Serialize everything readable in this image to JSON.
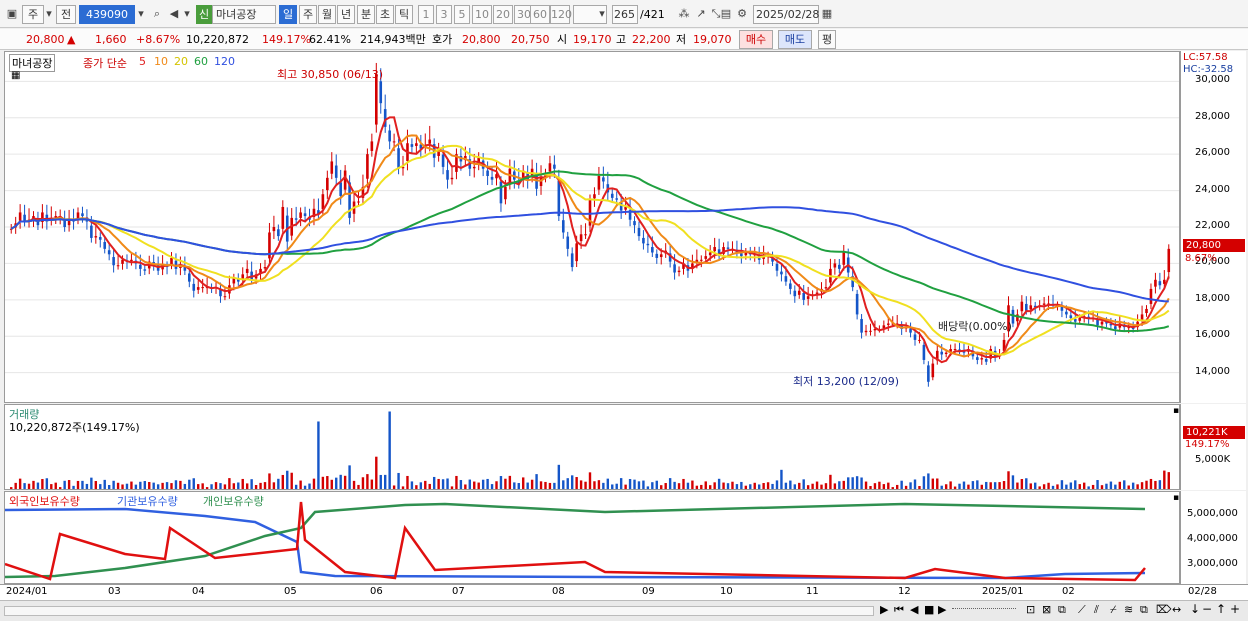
{
  "toolbar": {
    "market": "주",
    "prev": "전",
    "code": "439090",
    "badge": "신",
    "name": "마녀공장",
    "periods": [
      "일",
      "주",
      "월",
      "년",
      "분",
      "초",
      "틱"
    ],
    "active_period": "일",
    "intervals": [
      "1",
      "3",
      "5",
      "10",
      "20",
      "30",
      "60",
      "120"
    ],
    "count": "265",
    "total": "/421",
    "date": "2025/02/28"
  },
  "quote": {
    "price": "20,800",
    "arrow": "▲",
    "change": "1,660",
    "change_pct": "+8.67%",
    "volume": "10,220,872",
    "vol_ratio": "149.17%",
    "turnover": "62.41%",
    "amount": "214,943백만",
    "hoga_label": "호가",
    "ask": "20,800",
    "bid": "20,750",
    "open_label": "시",
    "open": "19,170",
    "high_label": "고",
    "high": "22,200",
    "low_label": "저",
    "low": "19,070",
    "buy": "매수",
    "sell": "매도",
    "avg": "평"
  },
  "colors": {
    "up": "#d40000",
    "down": "#1455c8",
    "ma5": "#e02020",
    "ma10": "#f08a18",
    "ma20": "#f0e020",
    "ma60": "#20a040",
    "ma120": "#3050e0",
    "foreign": "#e01010",
    "inst": "#3060e0",
    "indiv": "#309050"
  },
  "price_panel": {
    "name_tag": "마녀공장",
    "legend_prefix": "종가 단순",
    "ma_labels": [
      "5",
      "10",
      "20",
      "60",
      "120"
    ],
    "lc": "LC:57.58",
    "hc": "HC:-32.58",
    "high_note": "최고 30,850 (06/13)",
    "low_note": "최저 13,200 (12/09)",
    "dividend_note": "배당락(0.00%)",
    "last_price_tag": "20,800",
    "last_pct_tag": "8.67%"
  },
  "volume_panel": {
    "title": "거래량",
    "value": "10,220,872주(149.17%)",
    "axis_tag": "10,221K",
    "axis_pct": "149.17%",
    "tick": "5,000K"
  },
  "holding_panel": {
    "legend": [
      "외국인보유수량",
      "기관보유수량",
      "개인보유수량"
    ],
    "ticks": [
      "5,000,000",
      "4,000,000",
      "3,000,000"
    ]
  },
  "x_labels": [
    "2024/01",
    "03",
    "04",
    "05",
    "06",
    "07",
    "08",
    "09",
    "10",
    "11",
    "12",
    "2025/01",
    "02",
    "02/28"
  ],
  "chart_data": {
    "type": "candlestick",
    "y_axis": {
      "min": 12500,
      "max": 31500,
      "ticks": [
        14000,
        16000,
        18000,
        20000,
        22000,
        24000,
        26000,
        28000,
        30000
      ]
    },
    "closes": [
      21900,
      22200,
      22800,
      22300,
      22400,
      22600,
      22100,
      22800,
      22300,
      22500,
      22600,
      22600,
      22000,
      22400,
      22300,
      22800,
      22600,
      22300,
      21400,
      21500,
      21300,
      20800,
      20500,
      19900,
      19900,
      20200,
      20100,
      20200,
      20000,
      19700,
      19600,
      20100,
      20000,
      19600,
      19900,
      19800,
      20300,
      19700,
      19900,
      19600,
      19000,
      18500,
      18700,
      18700,
      18700,
      18600,
      18700,
      18200,
      18200,
      18800,
      19200,
      19000,
      19400,
      19700,
      19100,
      19400,
      19700,
      19800,
      21700,
      22000,
      21500,
      23100,
      21200,
      22500,
      22400,
      22800,
      22600,
      22400,
      23000,
      22700,
      23800,
      24700,
      25600,
      24700,
      23700,
      25100,
      22500,
      23400,
      23400,
      24200,
      26000,
      26700,
      30400,
      28800,
      27500,
      26700,
      26700,
      25200,
      25300,
      26600,
      26400,
      26600,
      26300,
      26500,
      26800,
      25800,
      26200,
      25300,
      24600,
      24700,
      26000,
      25600,
      25900,
      25200,
      25300,
      25800,
      25200,
      24800,
      24600,
      24900,
      23300,
      24200,
      25200,
      24600,
      24400,
      25100,
      24600,
      25200,
      24100,
      24700,
      24900,
      25500,
      25200,
      22600,
      21700,
      20800,
      19800,
      21100,
      21600,
      21600,
      23500,
      23800,
      24800,
      24500,
      23900,
      23600,
      23500,
      22900,
      23100,
      22400,
      22100,
      21500,
      21100,
      21000,
      20600,
      20300,
      20500,
      20700,
      20100,
      19500,
      19600,
      20000,
      19600,
      20000,
      20200,
      20200,
      20400,
      20600,
      20900,
      20400,
      20900,
      20800,
      20800,
      20600,
      20400,
      20600,
      20500,
      20500,
      20200,
      20400,
      20400,
      20100,
      19600,
      19400,
      19000,
      18600,
      18200,
      18500,
      18000,
      18200,
      18300,
      18400,
      18600,
      18700,
      19700,
      20000,
      19700,
      20600,
      19500,
      18700,
      17200,
      16200,
      16300,
      16300,
      16400,
      16400,
      16600,
      16700,
      16700,
      16700,
      16400,
      16500,
      16200,
      15800,
      15800,
      14700,
      13500,
      14500,
      15200,
      15000,
      15100,
      15300,
      15300,
      15200,
      15100,
      15300,
      14900,
      14700,
      14800,
      14600,
      15300,
      14900,
      15000,
      15800,
      17700,
      16700,
      17200,
      17900,
      17400,
      17700,
      17600,
      17700,
      17800,
      17800,
      17700,
      17700,
      17400,
      17200,
      17000,
      16800,
      17000,
      17100,
      17000,
      17000,
      16600,
      16800,
      16700,
      16600,
      16400,
      16700,
      16500,
      16500,
      16400,
      16800,
      17200,
      17500,
      18600,
      19100,
      18800,
      19100,
      20800
    ],
    "candles_note": "daily OHLC approximated from close series",
    "volume_max": 10221,
    "volume_peaks": [
      [
        69,
        8800
      ],
      [
        85,
        10100
      ],
      [
        173,
        2500
      ],
      [
        259,
        2400
      ],
      [
        262,
        3900
      ],
      [
        277,
        4500
      ],
      [
        280,
        6500
      ],
      [
        281,
        10221
      ]
    ]
  }
}
